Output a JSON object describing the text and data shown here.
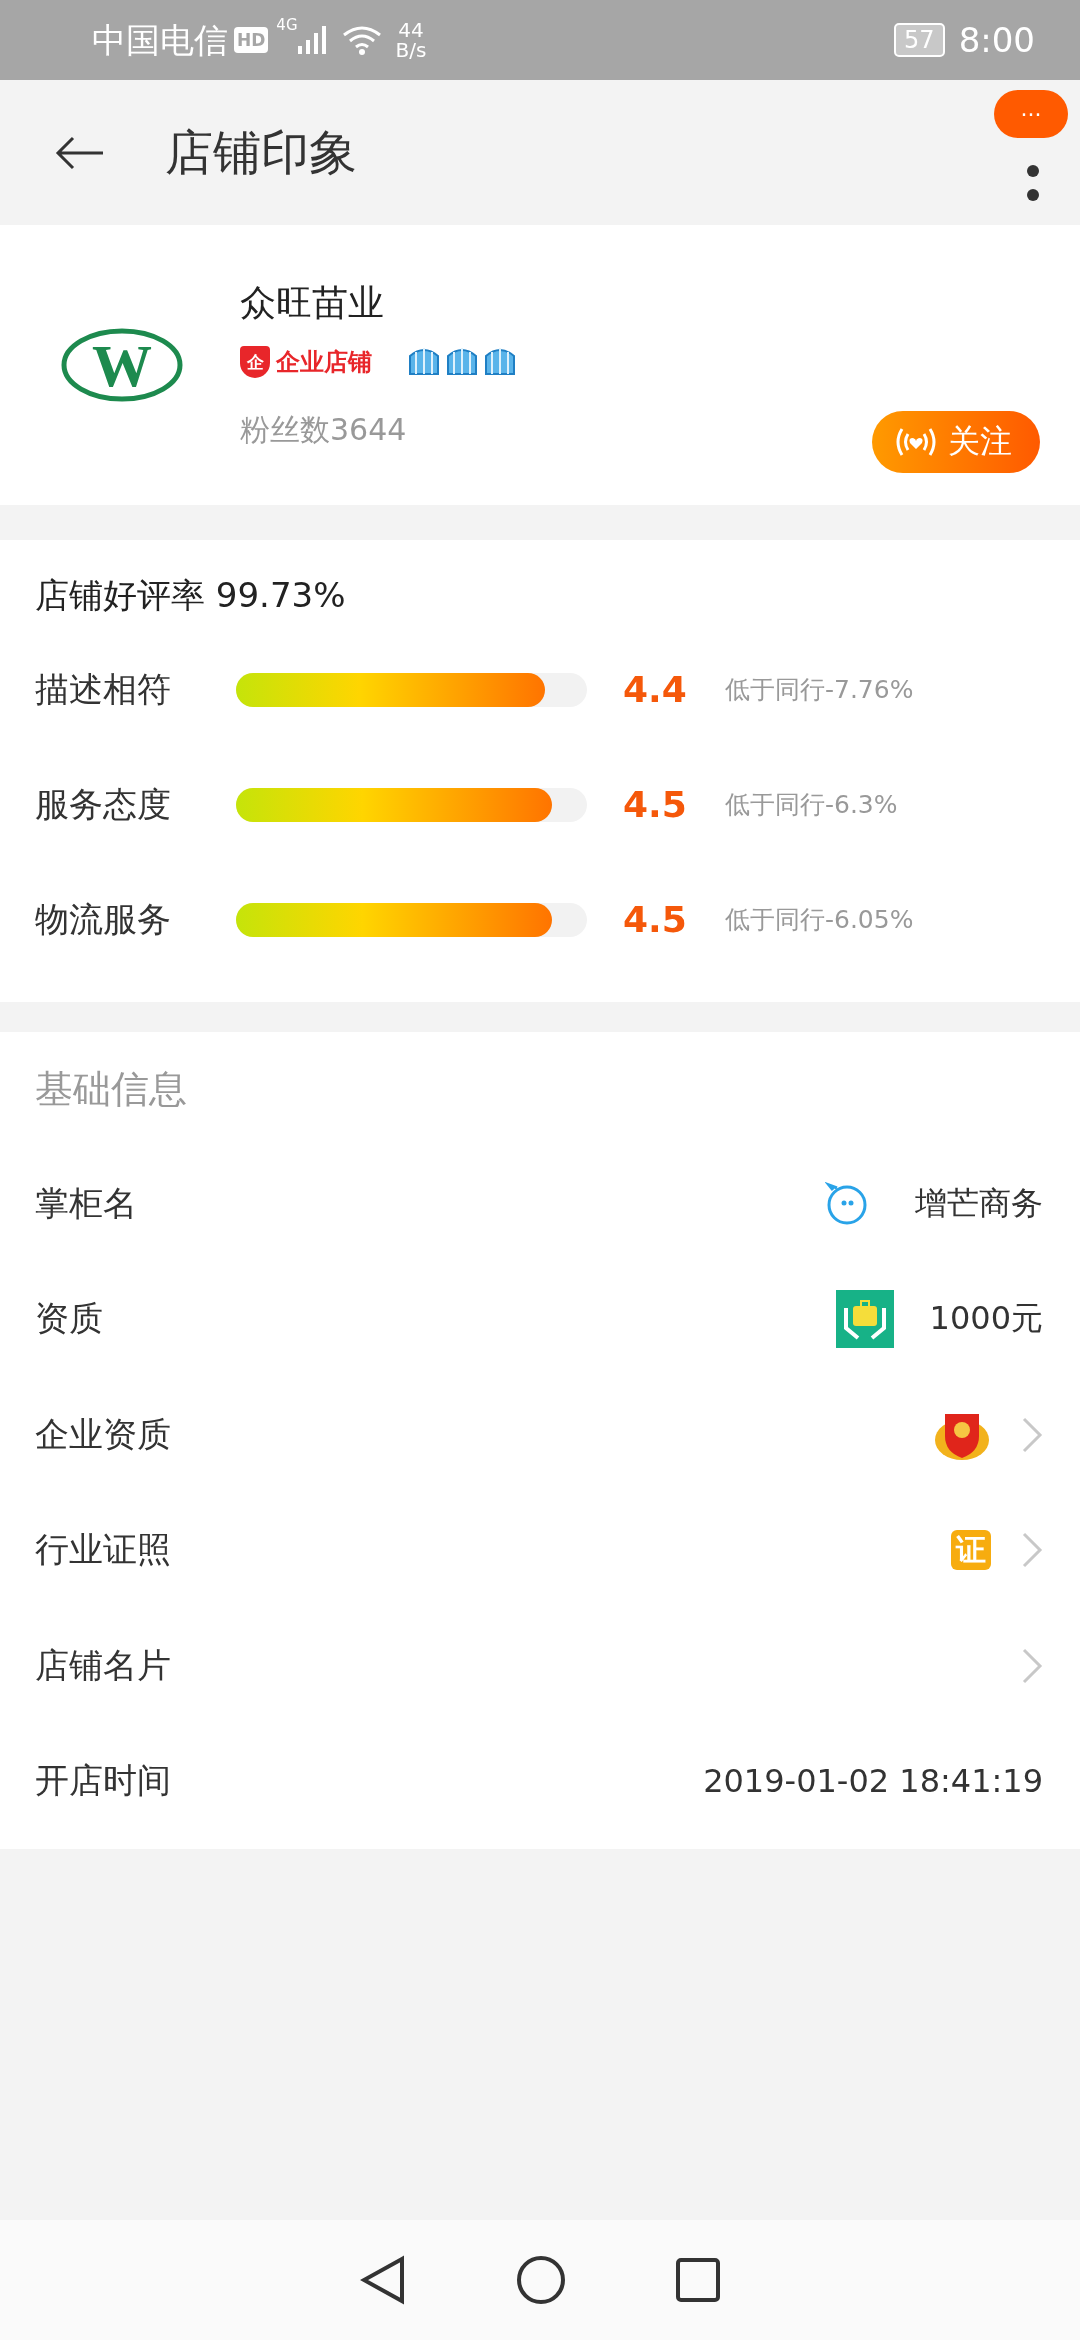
{
  "status_bar": {
    "carrier": "中国电信",
    "hd": "HD",
    "network": "4G",
    "speed": "44",
    "speed_unit": "B/s",
    "battery": "57",
    "time": "8:00"
  },
  "header": {
    "title": "店铺印象",
    "bubble": "···"
  },
  "store": {
    "logo_text": "W",
    "name": "众旺苗业",
    "badge": "企业店铺",
    "badge_mark": "企",
    "stars": 3,
    "fans": "粉丝数3644",
    "follow": "关注"
  },
  "ratings": {
    "summary": "店铺好评率 99.73%",
    "items": [
      {
        "label": "描述相符",
        "level": 0.88,
        "score": "4.4",
        "compare": "低于同行-7.76%"
      },
      {
        "label": "服务态度",
        "level": 0.9,
        "score": "4.5",
        "compare": "低于同行-6.3%"
      },
      {
        "label": "物流服务",
        "level": 0.9,
        "score": "4.5",
        "compare": "低于同行-6.05%"
      }
    ]
  },
  "basic_info": {
    "title": "基础信息",
    "rows": [
      {
        "kind": "owner",
        "label": "掌柜名",
        "value": "增芒商务"
      },
      {
        "kind": "deposit",
        "label": "资质",
        "value": "1000元"
      },
      {
        "kind": "business",
        "label": "企业资质"
      },
      {
        "kind": "permit",
        "label": "行业证照",
        "icon_text": "证"
      },
      {
        "kind": "card",
        "label": "店铺名片"
      },
      {
        "kind": "date",
        "label": "开店时间",
        "value": "2019-01-02 18:41:19"
      }
    ]
  }
}
